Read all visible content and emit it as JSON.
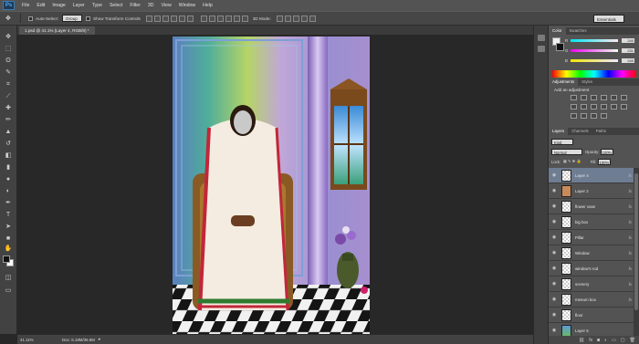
{
  "app": {
    "logo": "Ps"
  },
  "menu": [
    "File",
    "Edit",
    "Image",
    "Layer",
    "Type",
    "Select",
    "Filter",
    "3D",
    "View",
    "Window",
    "Help"
  ],
  "options_bar": {
    "auto_select_label": "Auto-Select:",
    "auto_select_target": "Group",
    "transform_controls_label": "Show Transform Controls",
    "mode_3d_label": "3D Mode:",
    "workspace": "Essentials"
  },
  "document": {
    "tab_title": "1.psd @ 41.1% (Layer 4, RGB/8) *",
    "zoom": "41.11%",
    "doc_info": "Doc: 6.18M/36.9M"
  },
  "panels": {
    "color": {
      "tabs": [
        "Color",
        "Swatches"
      ],
      "channels": [
        {
          "label": "R",
          "value": "240",
          "gradient": "linear-gradient(to right,#00e7f0,#ffe7f0)"
        },
        {
          "label": "G",
          "value": "231",
          "gradient": "linear-gradient(to right,#f000f0,#f0fff0)"
        },
        {
          "label": "B",
          "value": "240",
          "gradient": "linear-gradient(to right,#f0e700,#f0e7ff)"
        }
      ]
    },
    "adjustments": {
      "tabs": [
        "Adjustments",
        "Styles"
      ],
      "title": "Add an adjustment"
    },
    "layers": {
      "tabs": [
        "Layers",
        "Channels",
        "Paths"
      ],
      "filter_kind": "Kind",
      "blend_mode": "Normal",
      "opacity_label": "Opacity:",
      "opacity": "100%",
      "lock_label": "Lock:",
      "fill_label": "Fill:",
      "fill": "100%",
      "items": [
        {
          "name": "Layer 4",
          "fx": "fx",
          "selected": true
        },
        {
          "name": "Layer 2",
          "fx": "fx",
          "selected": false
        },
        {
          "name": "flower vase",
          "fx": "fx",
          "selected": false
        },
        {
          "name": "big box",
          "fx": "fx",
          "selected": false
        },
        {
          "name": "Pillar",
          "fx": "fx",
          "selected": false
        },
        {
          "name": "Window",
          "fx": "fx",
          "selected": false
        },
        {
          "name": "window's rod",
          "fx": "fx",
          "selected": false
        },
        {
          "name": "scenery",
          "fx": "fx",
          "selected": false
        },
        {
          "name": "meeum box",
          "fx": "fx",
          "selected": false
        },
        {
          "name": "floor",
          "fx": "",
          "selected": false
        },
        {
          "name": "Layer 5",
          "fx": "",
          "selected": false
        }
      ]
    }
  },
  "toolbox": {
    "tools": [
      "move-tool",
      "marquee-tool",
      "lasso-tool",
      "quick-select-tool",
      "crop-tool",
      "eyedropper-tool",
      "healing-brush-tool",
      "brush-tool",
      "clone-stamp-tool",
      "history-brush-tool",
      "eraser-tool",
      "gradient-tool",
      "blur-tool",
      "dodge-tool",
      "pen-tool",
      "type-tool",
      "path-select-tool",
      "shape-tool",
      "hand-tool",
      "zoom-tool"
    ]
  },
  "colors": {
    "fg": "#111111",
    "bg": "#ffffff",
    "accent_selected": "#6e7d92"
  }
}
